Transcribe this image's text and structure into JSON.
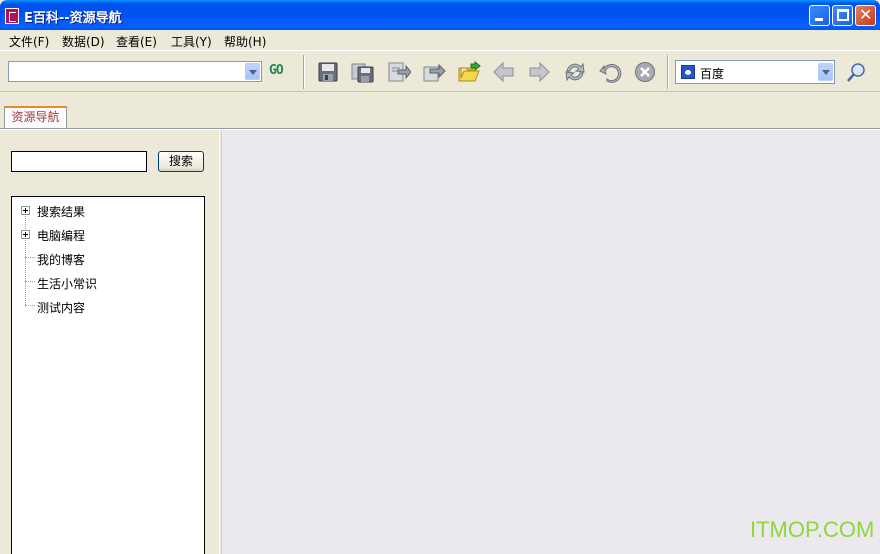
{
  "window": {
    "title": "E百科--资源导航"
  },
  "menu": {
    "items": [
      {
        "label": "文件(F)"
      },
      {
        "label": "数据(D)"
      },
      {
        "label": "查看(E)"
      },
      {
        "label": "工具(Y)"
      },
      {
        "label": "帮助(H)"
      }
    ]
  },
  "toolbar": {
    "address_value": "",
    "go_label": "GO",
    "icons": [
      "save-icon",
      "save-as-icon",
      "export-icon",
      "forward-doc-icon",
      "open-folder-icon",
      "back-arrow-icon",
      "forward-arrow-icon",
      "refresh-icon",
      "undo-icon",
      "stop-icon"
    ],
    "search_engine": "百度",
    "search_icon": "magnifier-icon"
  },
  "tabs": [
    {
      "label": "资源导航"
    }
  ],
  "sidebar": {
    "search_value": "",
    "search_button": "搜索",
    "tree": [
      {
        "label": "搜索结果",
        "expandable": true
      },
      {
        "label": "电脑编程",
        "expandable": true
      },
      {
        "label": "我的博客",
        "expandable": false
      },
      {
        "label": "生活小常识",
        "expandable": false
      },
      {
        "label": "测试内容",
        "expandable": false
      }
    ]
  },
  "watermark": "ITMOP.COM",
  "colors": {
    "titlebar": "#0054e3",
    "tab_accent": "#e68b2c",
    "go_text": "#1a8a5a",
    "watermark": "#8fd63c"
  }
}
